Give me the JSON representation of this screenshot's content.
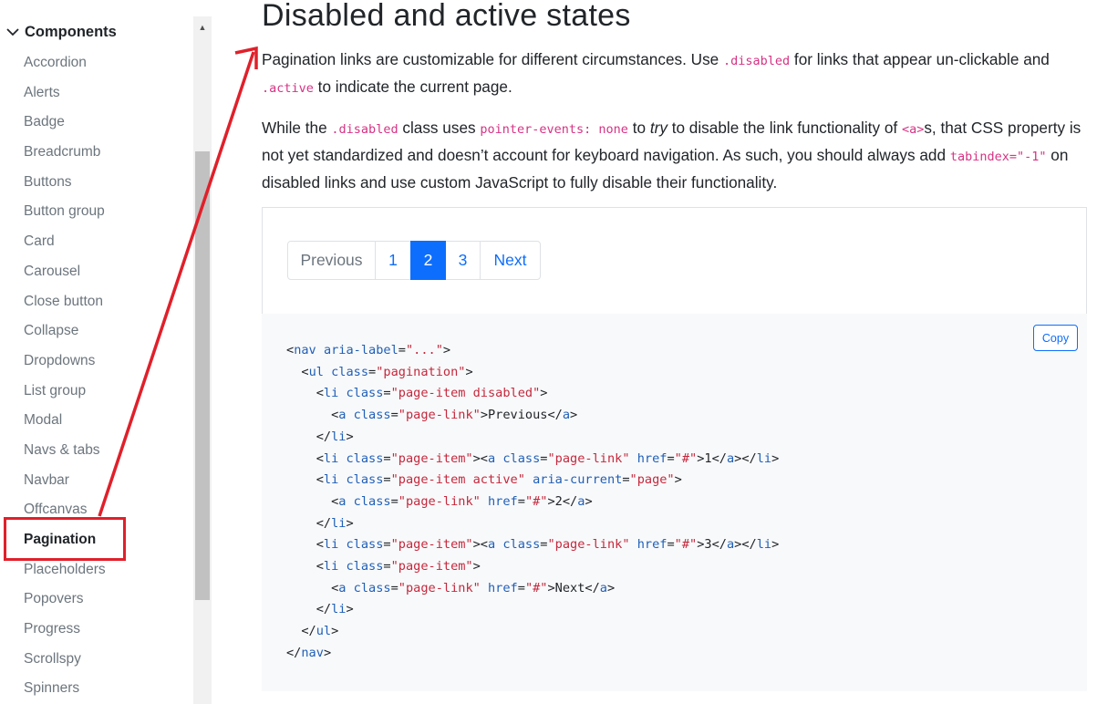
{
  "sidebar": {
    "section_label": "Components",
    "items": [
      {
        "label": "Accordion"
      },
      {
        "label": "Alerts"
      },
      {
        "label": "Badge"
      },
      {
        "label": "Breadcrumb"
      },
      {
        "label": "Buttons"
      },
      {
        "label": "Button group"
      },
      {
        "label": "Card"
      },
      {
        "label": "Carousel"
      },
      {
        "label": "Close button"
      },
      {
        "label": "Collapse"
      },
      {
        "label": "Dropdowns"
      },
      {
        "label": "List group"
      },
      {
        "label": "Modal"
      },
      {
        "label": "Navs & tabs"
      },
      {
        "label": "Navbar"
      },
      {
        "label": "Offcanvas"
      },
      {
        "label": "Pagination"
      },
      {
        "label": "Placeholders"
      },
      {
        "label": "Popovers"
      },
      {
        "label": "Progress"
      },
      {
        "label": "Scrollspy"
      },
      {
        "label": "Spinners"
      }
    ],
    "active_item": "Pagination"
  },
  "main": {
    "title": "Disabled and active states",
    "p1": {
      "t1": "Pagination links are customizable for different circumstances. Use ",
      "c1": ".disabled",
      "t2": " for links that appear un-clickable and ",
      "c2": ".active",
      "t3": " to indicate the current page."
    },
    "p2": {
      "t1": "While the ",
      "c1": ".disabled",
      "t2": " class uses ",
      "c2": "pointer-events: none",
      "t3": " to ",
      "em": "try",
      "t4": " to disable the link functionality of ",
      "c3": "<a>",
      "t5": "s, that CSS property is not yet standardized and doesn’t account for keyboard navigation. As such, you should always add ",
      "c4": "tabindex=\"-1\"",
      "t6": " on disabled links and use custom JavaScript to fully disable their functionality."
    },
    "pagination": {
      "previous": "Previous",
      "p1": "1",
      "p2": "2",
      "p3": "3",
      "next": "Next"
    },
    "copy_label": "Copy",
    "code_lines": [
      "<nav aria-label=\"...\">",
      "  <ul class=\"pagination\">",
      "    <li class=\"page-item disabled\">",
      "      <a class=\"page-link\">Previous</a>",
      "    </li>",
      "    <li class=\"page-item\"><a class=\"page-link\" href=\"#\">1</a></li>",
      "    <li class=\"page-item active\" aria-current=\"page\">",
      "      <a class=\"page-link\" href=\"#\">2</a>",
      "    </li>",
      "    <li class=\"page-item\"><a class=\"page-link\" href=\"#\">3</a></li>",
      "    <li class=\"page-item\">",
      "      <a class=\"page-link\" href=\"#\">Next</a>",
      "    </li>",
      "  </ul>",
      "</nav>"
    ]
  },
  "colors": {
    "accent": "#0d6efd",
    "annotation": "#e0202a",
    "code_inline": "#d63384"
  }
}
